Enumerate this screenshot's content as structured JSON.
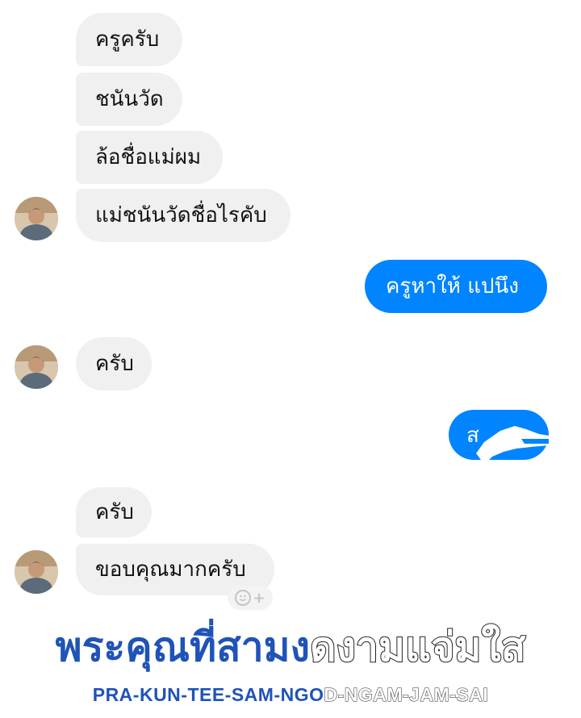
{
  "conversation": {
    "messages": [
      {
        "sender": "them",
        "text": "ครูครับ"
      },
      {
        "sender": "them",
        "text": "ชนันวัด"
      },
      {
        "sender": "them",
        "text": "ล้อชื่อแม่ผม"
      },
      {
        "sender": "them",
        "text": "แม่ชนันวัดชื่อไรคับ"
      },
      {
        "sender": "me",
        "text": "ครูหาให้ แปนึง"
      },
      {
        "sender": "them",
        "text": "ครับ"
      },
      {
        "sender": "me",
        "text": "ส",
        "censored": true
      },
      {
        "sender": "them",
        "text": "ครับ"
      },
      {
        "sender": "them",
        "text": "ขอบคุณมากครับ"
      }
    ]
  },
  "colors": {
    "incoming_bubble": "#f1f0f0",
    "outgoing_bubble": "#0084ff",
    "caption_blue": "#1f53b8"
  },
  "icons": {
    "reaction": "add-reaction-icon"
  },
  "caption": {
    "thai_part1": "พระคุณที่สามง",
    "thai_part2": "ดงามแจ่มใส",
    "roman_part1": "PRA-KUN-TEE-SAM-NGO",
    "roman_part2": "D-NGAM-JAM-SAI"
  }
}
